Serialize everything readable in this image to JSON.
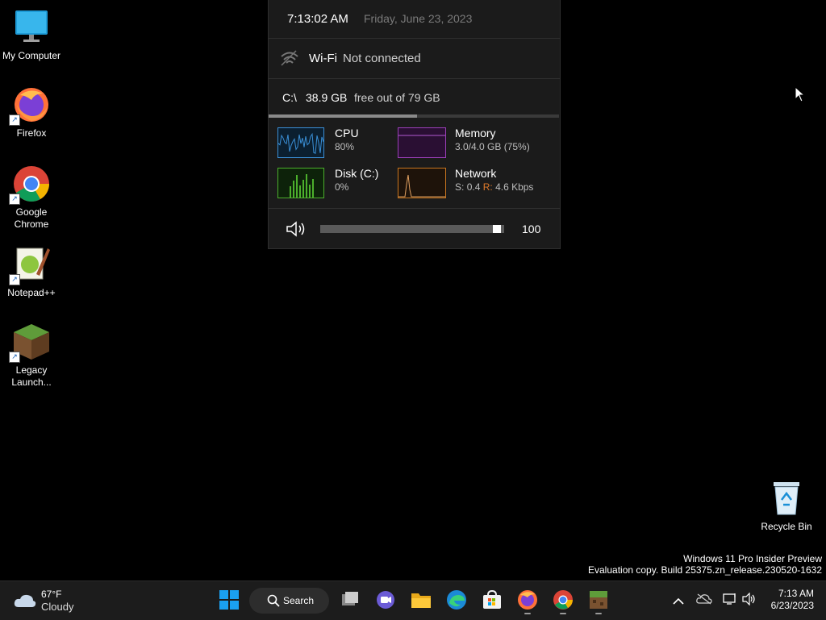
{
  "desktop": {
    "icons": [
      {
        "label": "My Computer",
        "icon": "monitor-icon"
      },
      {
        "label": "Firefox",
        "icon": "firefox-icon"
      },
      {
        "label": "Google Chrome",
        "icon": "chrome-icon"
      },
      {
        "label": "Notepad++",
        "icon": "notepadpp-icon"
      },
      {
        "label": "Legacy Launch...",
        "icon": "minecraft-icon"
      }
    ],
    "recycle_bin": {
      "label": "Recycle Bin",
      "icon": "recycle-bin-icon"
    },
    "watermark": {
      "line1": "Windows 11 Pro Insider Preview",
      "line2": "Evaluation copy. Build 25375.zn_release.230520-1632"
    }
  },
  "panel": {
    "time": "7:13:02 AM",
    "date": "Friday, June 23, 2023",
    "wifi": {
      "label": "Wi-Fi",
      "status": "Not connected"
    },
    "drive": {
      "letter": "C:\\",
      "free": "38.9 GB",
      "rest": "free out of 79 GB",
      "used_fraction": 0.51
    },
    "metrics": {
      "cpu": {
        "title": "CPU",
        "value": "80%",
        "color": "#3a8fd6"
      },
      "memory": {
        "title": "Memory",
        "value": "3.0/4.0 GB (75%)",
        "color": "#9b3fb8"
      },
      "disk": {
        "title": "Disk (C:)",
        "value": "0%",
        "color": "#4caf2c"
      },
      "network": {
        "title": "Network",
        "send_label": "S:",
        "send": "0.4",
        "recv_label": "R:",
        "recv": "4.6 Kbps",
        "color": "#c9761f"
      }
    },
    "volume": {
      "value": "100",
      "level": 1.0
    }
  },
  "taskbar": {
    "weather": {
      "temp": "67°F",
      "cond": "Cloudy"
    },
    "search_label": "Search",
    "clock": {
      "time": "7:13 AM",
      "date": "6/23/2023"
    },
    "apps": [
      "start-icon",
      "search-button",
      "task-view-icon",
      "chat-icon",
      "file-explorer-icon",
      "edge-icon",
      "store-icon",
      "firefox-icon",
      "chrome-icon",
      "minecraft-icon"
    ],
    "tray": [
      "chevron-up-icon",
      "onedrive-offline-icon",
      "network-icon",
      "volume-icon"
    ]
  }
}
